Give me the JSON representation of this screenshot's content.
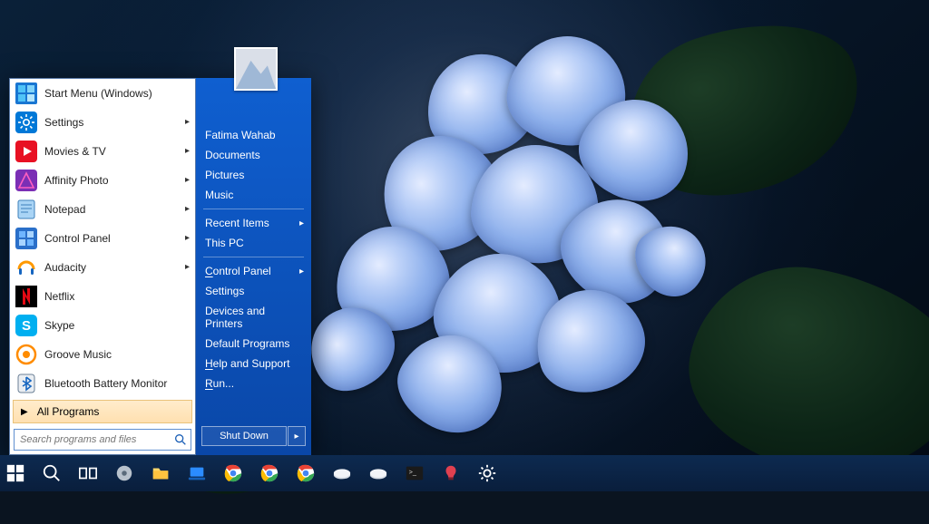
{
  "left_pane": {
    "items": [
      {
        "label": "Start Menu (Windows)",
        "submenu": false
      },
      {
        "label": "Settings",
        "submenu": true
      },
      {
        "label": "Movies & TV",
        "submenu": true
      },
      {
        "label": "Affinity Photo",
        "submenu": true
      },
      {
        "label": "Notepad",
        "submenu": true
      },
      {
        "label": "Control Panel",
        "submenu": true
      },
      {
        "label": "Audacity",
        "submenu": true
      },
      {
        "label": "Netflix",
        "submenu": false
      },
      {
        "label": "Skype",
        "submenu": false
      },
      {
        "label": "Groove Music",
        "submenu": false
      },
      {
        "label": "Bluetooth Battery Monitor",
        "submenu": false
      }
    ],
    "all_programs": "All Programs",
    "search_placeholder": "Search programs and files"
  },
  "right_pane": {
    "user_name": "Fatima Wahab",
    "items1": [
      "Documents",
      "Pictures",
      "Music"
    ],
    "items2": [
      "Recent Items",
      "This PC"
    ],
    "items2_submenu": [
      true,
      false
    ],
    "items3": [
      "Control Panel",
      "Settings",
      "Devices and Printers",
      "Default Programs",
      "Help and Support",
      "Run..."
    ],
    "items3_submenu": [
      true,
      false,
      false,
      false,
      false,
      false
    ],
    "items3_underline_first": [
      true,
      false,
      false,
      false,
      true,
      true
    ],
    "shutdown": "Shut Down"
  },
  "taskbar_icons": [
    "start",
    "search",
    "task-view",
    "app-disc",
    "file-explorer",
    "app-laptop",
    "chrome-a",
    "chrome-b",
    "chrome-c",
    "app-flat1",
    "app-flat2",
    "terminal",
    "app-candy",
    "settings-gear"
  ],
  "colors": {
    "accent_blue": "#0d5fd0",
    "taskbar_bg": "#0d2a50",
    "highlight_amber": "#ffe0b0"
  }
}
